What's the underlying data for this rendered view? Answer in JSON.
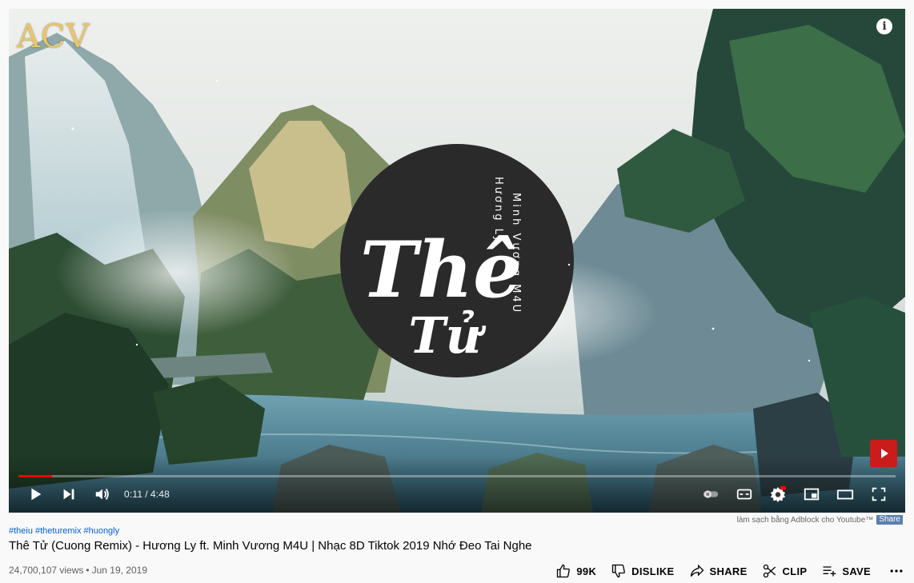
{
  "player": {
    "channel_logo_text": "ACV",
    "info_icon_glyph": "i",
    "time_current": "0:11",
    "time_separator": "/",
    "time_total": "4:48",
    "progress_fraction": 0.038,
    "icons": [
      "play-icon",
      "next-icon",
      "volume-icon",
      "autoplay-toggle-icon",
      "subtitles-icon",
      "settings-icon",
      "miniplayer-icon",
      "theater-icon",
      "fullscreen-icon",
      "info-icon"
    ],
    "accent_color": "#ff0000",
    "watermark_color": "#cc1b1b"
  },
  "adblock": {
    "text": "làm sạch bằng Adblock cho Youtube™",
    "share_label": "Share"
  },
  "video": {
    "hashtags": [
      "#theiu",
      "#theturemix",
      "#huongly"
    ],
    "title": "Thê Tử (Cuong Remix) - Hương Ly ft. Minh Vương M4U | Nhạc 8D Tiktok 2019 Nhớ Đeo Tai Nghe",
    "views": "24,700,107 views",
    "dot": "•",
    "date": "Jun 19, 2019"
  },
  "actions": {
    "like_count": "99K",
    "dislike_label": "DISLIKE",
    "share_label": "SHARE",
    "clip_label": "CLIP",
    "save_label": "SAVE"
  }
}
